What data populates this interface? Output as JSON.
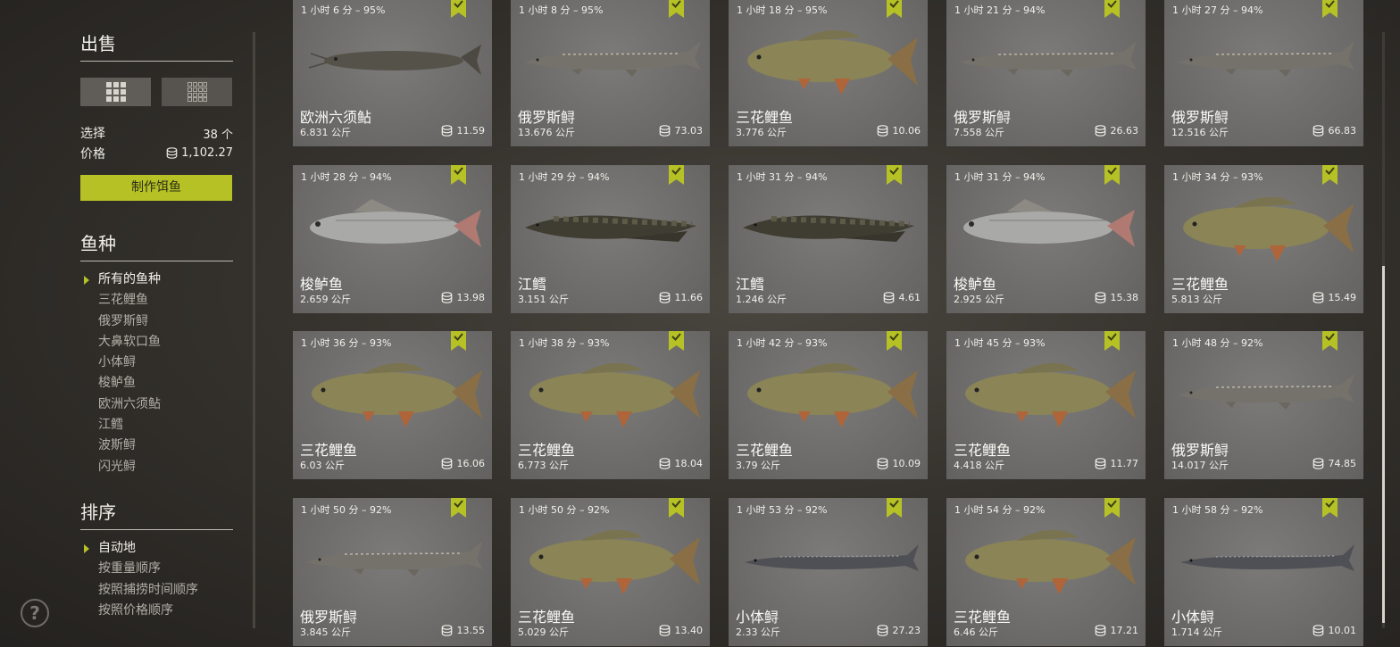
{
  "sidebar": {
    "sell_title": "出售",
    "select_label": "选择",
    "select_value": "38 个",
    "price_label": "价格",
    "price_value": "1,102.27",
    "make_bait_label": "制作饵鱼",
    "species_title": "鱼种",
    "species": [
      "所有的鱼种",
      "三花鲤鱼",
      "俄罗斯鲟",
      "大鼻软口鱼",
      "小体鲟",
      "梭鲈鱼",
      "欧洲六须鲇",
      "江鳕",
      "波斯鲟",
      "闪光鲟"
    ],
    "sort_title": "排序",
    "sort_options": [
      "自动地",
      "按重量顺序",
      "按照捕捞时间顺序",
      "按照价格顺序"
    ]
  },
  "help_label": "?",
  "colors": {
    "accent": "#b6c126",
    "card_bg": "#6f6e6c"
  },
  "fish_cards": [
    {
      "time": "1 小时 6 分 – 95%",
      "name": "欧洲六须鲇",
      "weight": "6.831 公斤",
      "price": "11.59",
      "kind": "catfish"
    },
    {
      "time": "1 小时 8 分 – 95%",
      "name": "俄罗斯鲟",
      "weight": "13.676 公斤",
      "price": "73.03",
      "kind": "sturgeon"
    },
    {
      "time": "1 小时 18 分 – 95%",
      "name": "三花鲤鱼",
      "weight": "3.776 公斤",
      "price": "10.06",
      "kind": "carp"
    },
    {
      "time": "1 小时 21 分 – 94%",
      "name": "俄罗斯鲟",
      "weight": "7.558 公斤",
      "price": "26.63",
      "kind": "sturgeon"
    },
    {
      "time": "1 小时 27 分 – 94%",
      "name": "俄罗斯鲟",
      "weight": "12.516 公斤",
      "price": "66.83",
      "kind": "sturgeon"
    },
    {
      "time": "1 小时 28 分 – 94%",
      "name": "梭鲈鱼",
      "weight": "2.659 公斤",
      "price": "13.98",
      "kind": "zander"
    },
    {
      "time": "1 小时 29 分 – 94%",
      "name": "江鳕",
      "weight": "3.151 公斤",
      "price": "11.66",
      "kind": "burbot"
    },
    {
      "time": "1 小时 31 分 – 94%",
      "name": "江鳕",
      "weight": "1.246 公斤",
      "price": "4.61",
      "kind": "burbot"
    },
    {
      "time": "1 小时 31 分 – 94%",
      "name": "梭鲈鱼",
      "weight": "2.925 公斤",
      "price": "15.38",
      "kind": "zander"
    },
    {
      "time": "1 小时 34 分 – 93%",
      "name": "三花鲤鱼",
      "weight": "5.813 公斤",
      "price": "15.49",
      "kind": "carp"
    },
    {
      "time": "1 小时 36 分 – 93%",
      "name": "三花鲤鱼",
      "weight": "6.03 公斤",
      "price": "16.06",
      "kind": "carp"
    },
    {
      "time": "1 小时 38 分 – 93%",
      "name": "三花鲤鱼",
      "weight": "6.773 公斤",
      "price": "18.04",
      "kind": "carp"
    },
    {
      "time": "1 小时 42 分 – 93%",
      "name": "三花鲤鱼",
      "weight": "3.79 公斤",
      "price": "10.09",
      "kind": "carp"
    },
    {
      "time": "1 小时 45 分 – 93%",
      "name": "三花鲤鱼",
      "weight": "4.418 公斤",
      "price": "11.77",
      "kind": "carp"
    },
    {
      "time": "1 小时 48 分 – 92%",
      "name": "俄罗斯鲟",
      "weight": "14.017 公斤",
      "price": "74.85",
      "kind": "sturgeon"
    },
    {
      "time": "1 小时 50 分 – 92%",
      "name": "俄罗斯鲟",
      "weight": "3.845 公斤",
      "price": "13.55",
      "kind": "sturgeon"
    },
    {
      "time": "1 小时 50 分 – 92%",
      "name": "三花鲤鱼",
      "weight": "5.029 公斤",
      "price": "13.40",
      "kind": "carp"
    },
    {
      "time": "1 小时 53 分 – 92%",
      "name": "小体鲟",
      "weight": "2.33 公斤",
      "price": "27.23",
      "kind": "sterlet"
    },
    {
      "time": "1 小时 54 分 – 92%",
      "name": "三花鲤鱼",
      "weight": "6.46 公斤",
      "price": "17.21",
      "kind": "carp"
    },
    {
      "time": "1 小时 58 分 – 92%",
      "name": "小体鲟",
      "weight": "1.714 公斤",
      "price": "10.01",
      "kind": "sterlet"
    }
  ]
}
